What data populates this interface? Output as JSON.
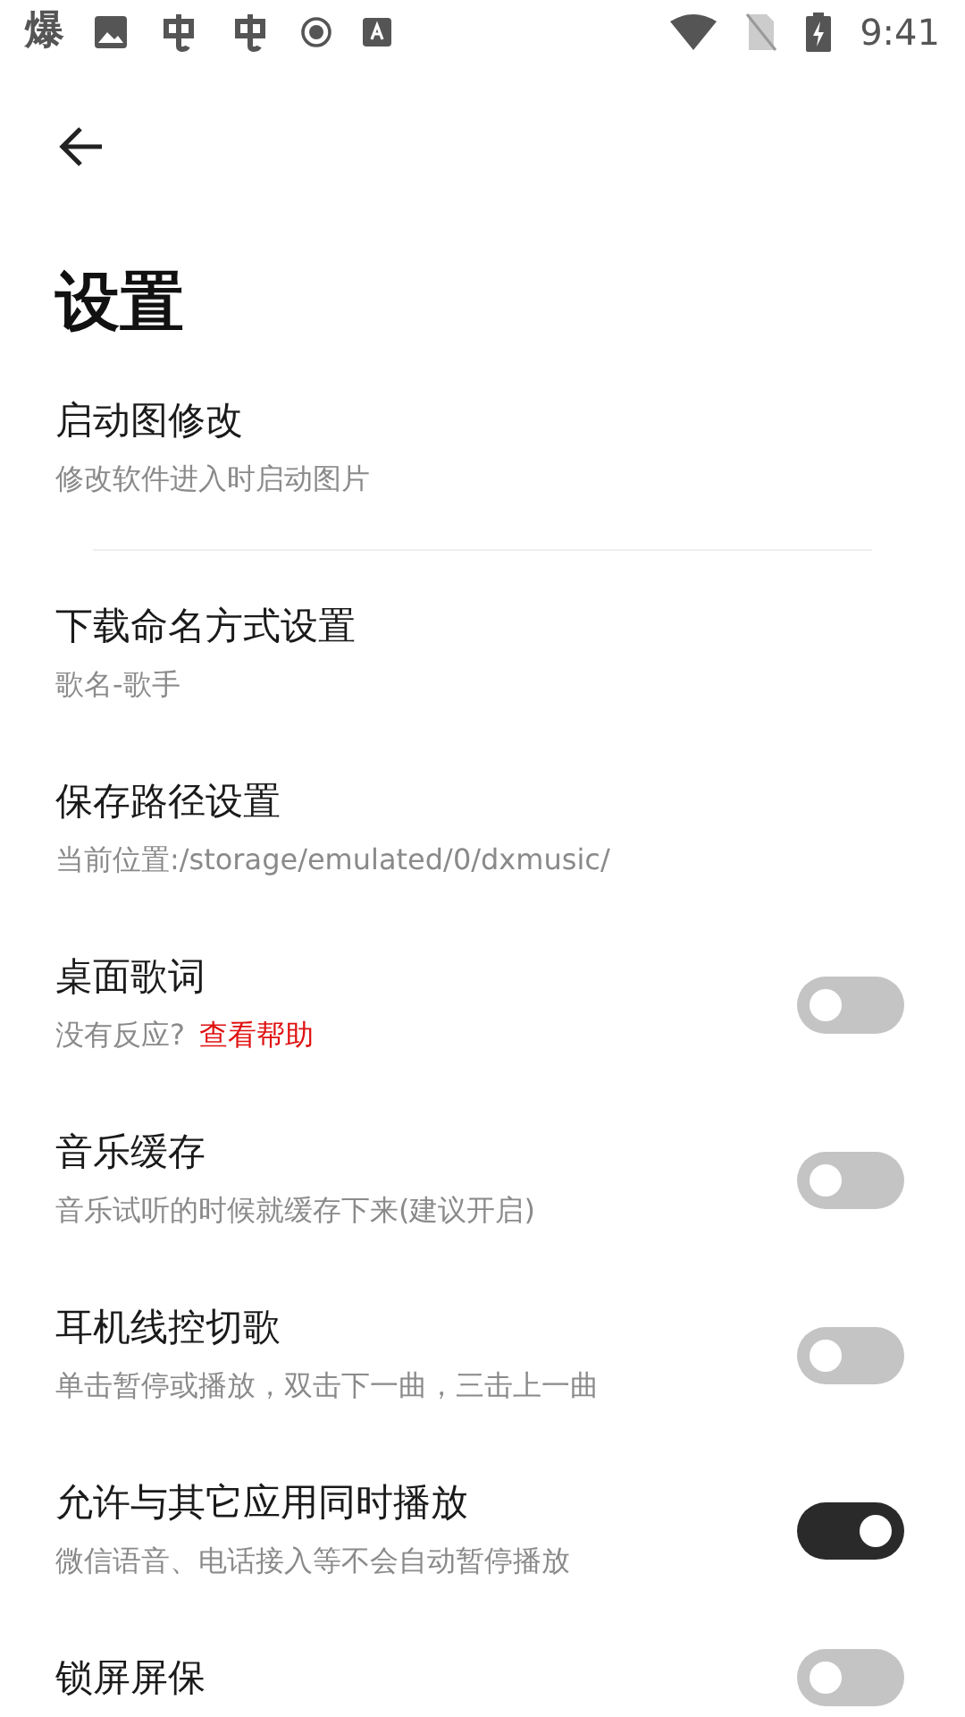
{
  "status_bar": {
    "notification_text": "爆",
    "time": "9:41"
  },
  "title": "设置",
  "items": [
    {
      "kind": "text",
      "title": "启动图修改",
      "subtitle": "修改软件进入时启动图片",
      "divider_after": true
    },
    {
      "kind": "text",
      "title": "下载命名方式设置",
      "subtitle": "歌名-歌手",
      "divider_after": false
    },
    {
      "kind": "text",
      "title": "保存路径设置",
      "subtitle": "当前位置:/storage/emulated/0/dxmusic/",
      "divider_after": false
    },
    {
      "kind": "switch",
      "title": "桌面歌词",
      "subtitle": "没有反应?",
      "link": "查看帮助",
      "on": false,
      "divider_after": false
    },
    {
      "kind": "switch",
      "title": "音乐缓存",
      "subtitle": "音乐试听的时候就缓存下来(建议开启)",
      "on": false,
      "divider_after": false
    },
    {
      "kind": "switch",
      "title": "耳机线控切歌",
      "subtitle": "单击暂停或播放，双击下一曲，三击上一曲",
      "on": false,
      "divider_after": false
    },
    {
      "kind": "switch",
      "title": "允许与其它应用同时播放",
      "subtitle": "微信语音、电话接入等不会自动暂停播放",
      "on": true,
      "divider_after": false
    },
    {
      "kind": "switch",
      "title": "锁屏屏保",
      "on": false,
      "divider_after": false
    }
  ]
}
